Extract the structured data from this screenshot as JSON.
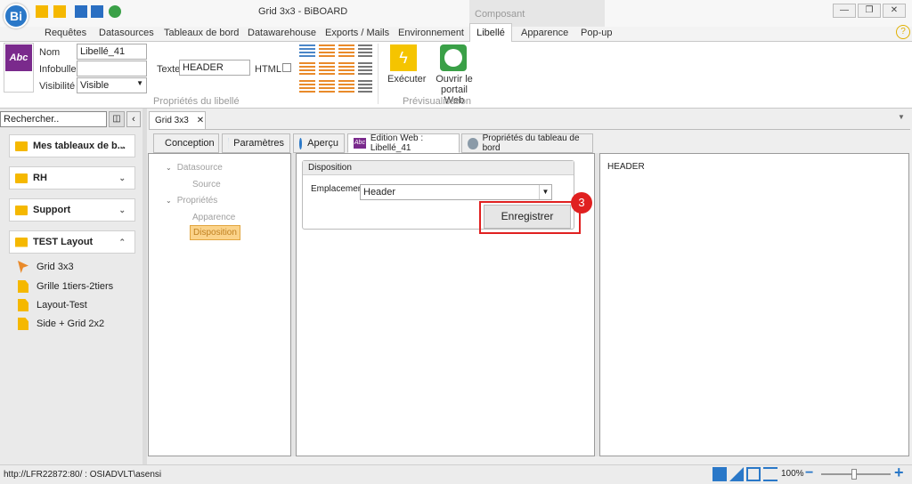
{
  "app": {
    "window_title": "Grid 3x3 - BiBOARD",
    "logo_text": "Bi",
    "context_group": "Composant",
    "help": "?"
  },
  "ribbon_tabs": [
    "Requêtes",
    "Datasources",
    "Tableaux de bord",
    "Datawarehouse",
    "Exports / Mails",
    "Environnement",
    "Libellé",
    "Apparence",
    "Pop-up"
  ],
  "ribbon": {
    "abc_icon": "Abc",
    "nom_label": "Nom",
    "nom_value": "Libellé_41",
    "infobulle_label": "Infobulle",
    "infobulle_value": "",
    "visibilite_label": "Visibilité",
    "visibilite_value": "Visible",
    "texte_label": "Texte",
    "texte_value": "HEADER",
    "html_label": "HTML",
    "group_props": "Propriétés du libellé",
    "executer": "Exécuter",
    "ouvrir": "Ouvrir le portail Web",
    "group_preview": "Prévisualisation"
  },
  "search": {
    "placeholder": "Rechercher.."
  },
  "nav": {
    "groups": [
      {
        "label": "Mes tableaux de b...",
        "chevron": "⌄"
      },
      {
        "label": "RH",
        "chevron": "⌄"
      },
      {
        "label": "Support",
        "chevron": "⌄"
      },
      {
        "label": "TEST Layout",
        "chevron": "⌃"
      }
    ],
    "items": [
      "Grid 3x3",
      "Grille 1tiers-2tiers",
      "Layout-Test",
      "Side + Grid 2x2"
    ]
  },
  "doc_tab": {
    "label": "Grid 3x3",
    "close": "✕"
  },
  "content_tabs": [
    "Conception",
    "Paramètres",
    "Aperçu",
    "Edition Web : Libellé_41",
    "Propriétés du tableau de bord"
  ],
  "tree": {
    "datasource": "Datasource",
    "source": "Source",
    "proprietes": "Propriétés",
    "apparence": "Apparence",
    "disposition": "Disposition"
  },
  "disposition": {
    "title": "Disposition",
    "emplacement_label": "Emplacement",
    "emplacement_value": "Header",
    "save_button": "Enregistrer",
    "badge": "3"
  },
  "preview": {
    "text": "HEADER"
  },
  "status": {
    "connection": "http://LFR22872:80/ : OSIADVLT\\asensi",
    "zoom": "100%"
  },
  "colors": {
    "accent": "#e02020",
    "brand": "#7a2a8c",
    "folder": "#f5b800"
  }
}
